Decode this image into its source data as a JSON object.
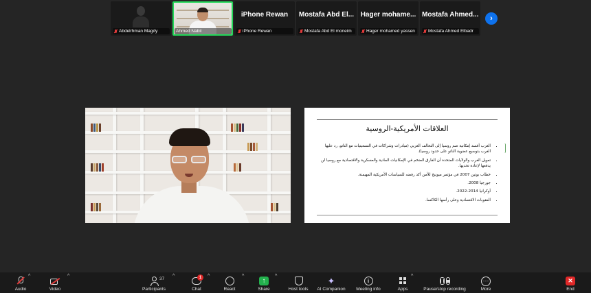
{
  "participants_strip": {
    "tiles": [
      {
        "display": "",
        "label": "Abdelrhman Magdy",
        "muted": true,
        "video": "avatar"
      },
      {
        "display": "",
        "label": "Ahmed Nabil",
        "muted": false,
        "video": "live",
        "active": true
      },
      {
        "display": "iPhone Rewan",
        "label": "iPhone Rewan",
        "muted": true
      },
      {
        "display": "Mostafa Abd El...",
        "label": "Mostafa Abd El moneim",
        "muted": true
      },
      {
        "display": "Hager mohame...",
        "label": "Hager mohamed yassen",
        "muted": true
      },
      {
        "display": "Mostafa Ahmed...",
        "label": "Mostafa Ahmed Elbadr",
        "muted": true
      }
    ],
    "next_icon": "chevron-right-icon"
  },
  "slide": {
    "title": "العلاقات الأمريكية-الروسية",
    "bullets": [
      "الغرب أفسد إمكانية ضم روسيا إلى التحالف الغربي (مبادرات وشراكات في التسعينيات مع الناتو، رد عليها الغرب بتوسيع عضوية الناتو على حدود روسيا).",
      "تعويل الغرب والولايات المتحدة أن الفارق الضخم في الإمكانيات المادية والعسكرية والاقتصادية مع روسيا لن يدفعها لإعادة تحديها.",
      "خطاب بوتين 2007 في مؤتمر ميونيخ للأمن أكد رفضه للسياسات الأمريكية المهيمنة.",
      "جورجيا 2008.",
      "أوكرانيا 2014-2022.",
      "العقوبات الاقتصادية وعلى رأسها الكاكسا."
    ]
  },
  "toolbar": {
    "audio": {
      "label": "Audio",
      "icon": "mic-muted-icon"
    },
    "video": {
      "label": "Video",
      "icon": "video-off-icon"
    },
    "participants": {
      "label": "Participants",
      "count": "37",
      "icon": "people-icon"
    },
    "chat": {
      "label": "Chat",
      "badge": "1",
      "icon": "chat-icon"
    },
    "react": {
      "label": "React",
      "icon": "heart-icon"
    },
    "share": {
      "label": "Share",
      "icon": "share-screen-icon"
    },
    "host_tools": {
      "label": "Host tools",
      "icon": "shield-icon"
    },
    "ai_companion": {
      "label": "AI Companion",
      "icon": "sparkle-icon"
    },
    "meeting_info": {
      "label": "Meeting info",
      "icon": "info-icon"
    },
    "apps": {
      "label": "Apps",
      "icon": "apps-icon"
    },
    "recording": {
      "label": "Pause/stop recording",
      "icon": "pause-stop-icon"
    },
    "more": {
      "label": "More",
      "icon": "more-icon"
    },
    "end": {
      "label": "End",
      "icon": "end-call-icon"
    }
  },
  "colors": {
    "background": "#252525",
    "toolbar": "#1a1a1a",
    "active_speaker": "#23d959",
    "share_green": "#23b14d",
    "end_red": "#e02828",
    "accent_blue": "#0e72ed"
  }
}
